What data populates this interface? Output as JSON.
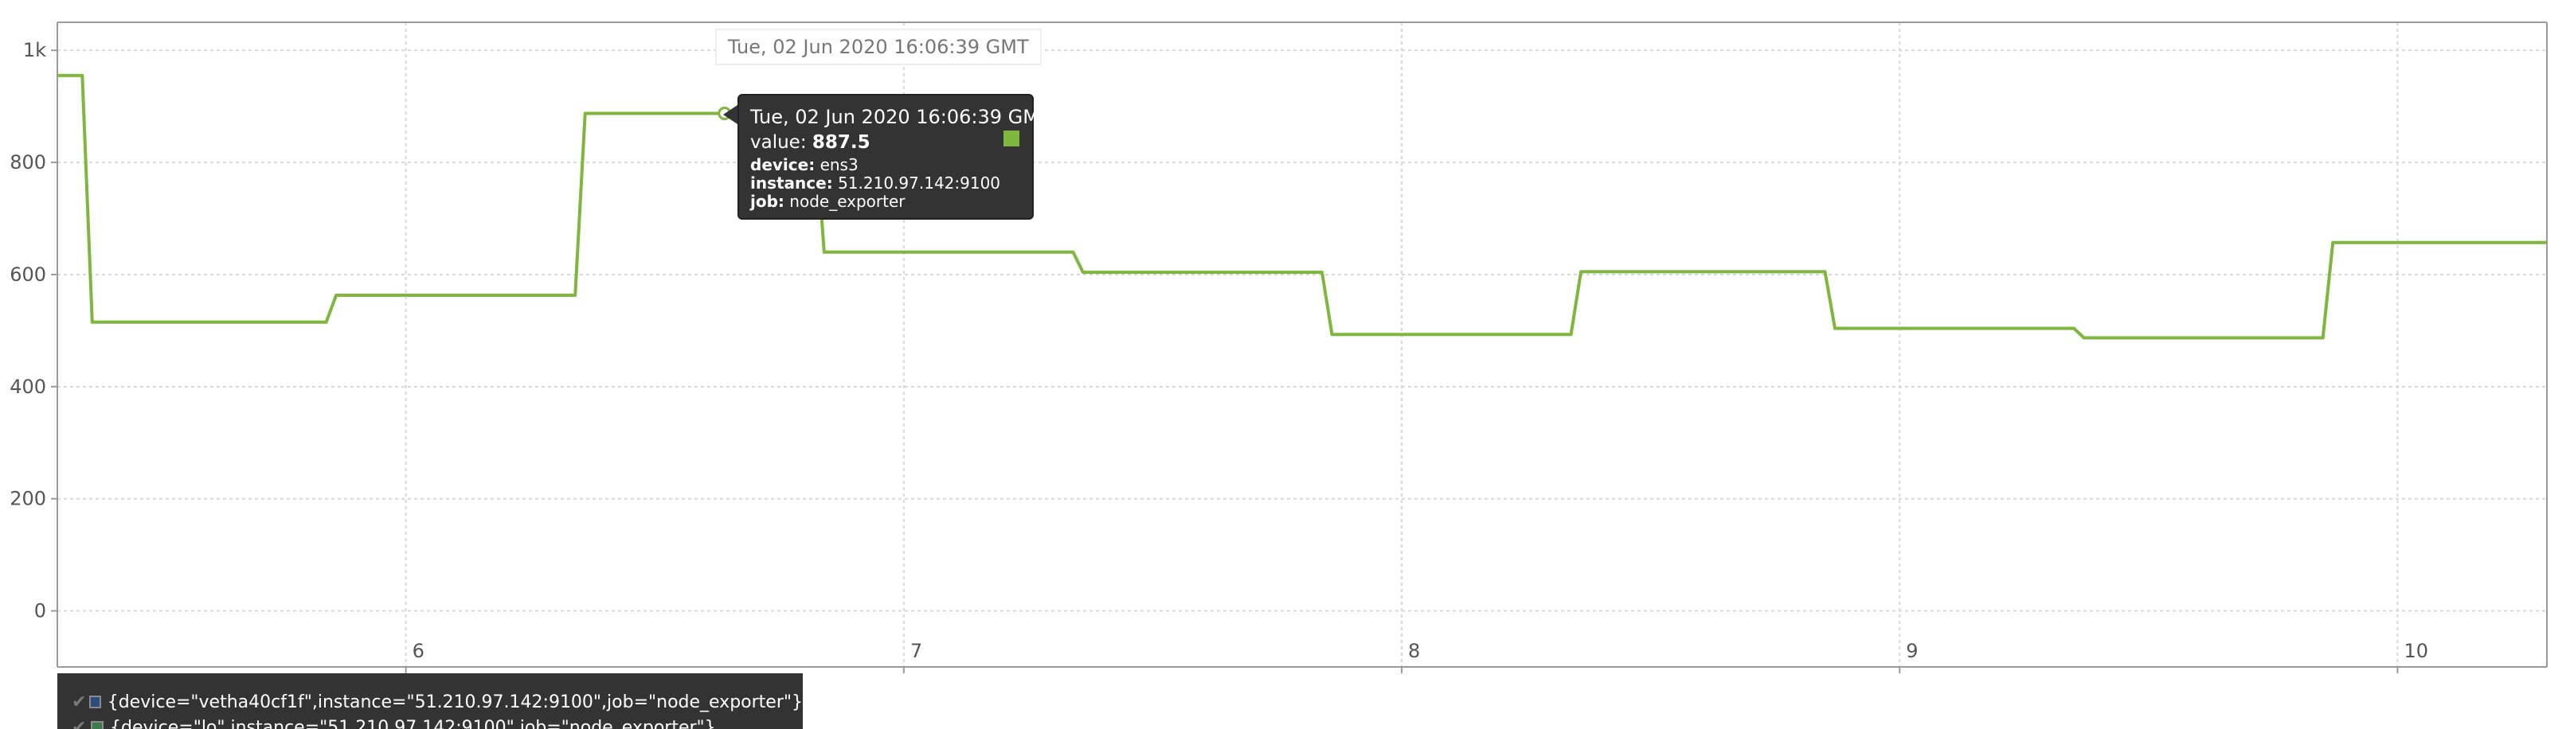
{
  "chart_data": {
    "type": "line",
    "x_axis": {
      "ticks": [
        "6",
        "7",
        "8",
        "9",
        "10"
      ],
      "min": 5.3,
      "max": 10.3
    },
    "y_axis": {
      "ticks": [
        "0",
        "200",
        "400",
        "600",
        "800",
        "1k"
      ],
      "ylim": [
        -100,
        1050
      ]
    },
    "grid": true,
    "series": [
      {
        "name": "{device=\"ens3\",instance=\"51.210.97.142:9100\",job=\"node_exporter\"}",
        "color": "#7eb63e",
        "points": [
          [
            5.3,
            955
          ],
          [
            5.35,
            955
          ],
          [
            5.37,
            515
          ],
          [
            5.84,
            515
          ],
          [
            5.86,
            563
          ],
          [
            6.34,
            563
          ],
          [
            6.36,
            887.5
          ],
          [
            6.82,
            887.5
          ],
          [
            6.84,
            640
          ],
          [
            7.34,
            640
          ],
          [
            7.36,
            604
          ],
          [
            7.84,
            604
          ],
          [
            7.86,
            493
          ],
          [
            8.34,
            493
          ],
          [
            8.36,
            605
          ],
          [
            8.85,
            605
          ],
          [
            8.87,
            504
          ],
          [
            9.35,
            504
          ],
          [
            9.37,
            487
          ],
          [
            9.85,
            487
          ],
          [
            9.87,
            657
          ],
          [
            10.3,
            657
          ]
        ]
      }
    ]
  },
  "hover": {
    "time_label": "Tue, 02 Jun 2020 16:06:39 GMT",
    "x": 6.64,
    "y": 887.5
  },
  "tooltip": {
    "title": "Tue, 02 Jun 2020 16:06:39 GMT",
    "value_label": "value:",
    "value": "887.5",
    "swatch_color": "#7eb63e",
    "rows": [
      {
        "key": "device",
        "value": "ens3"
      },
      {
        "key": "instance",
        "value": "51.210.97.142:9100"
      },
      {
        "key": "job",
        "value": "node_exporter"
      }
    ]
  },
  "legend": {
    "items": [
      {
        "label": "{device=\"vetha40cf1f\",instance=\"51.210.97.142:9100\",job=\"node_exporter\"}",
        "color": "#2d4d7c",
        "check": "✔"
      },
      {
        "label": "{device=\"lo\",instance=\"51.210.97.142:9100\",job=\"node_exporter\"}",
        "color": "#3c7a4c",
        "check": "✔"
      }
    ]
  }
}
